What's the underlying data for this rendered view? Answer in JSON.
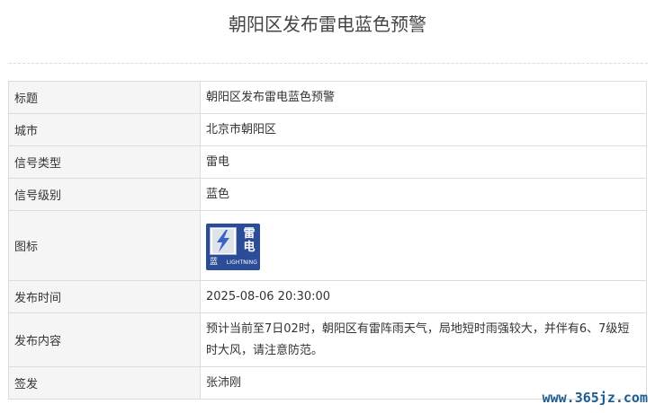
{
  "page": {
    "title": "朝阳区发布雷电蓝色预警"
  },
  "table": {
    "rows": [
      {
        "key": "标题",
        "value": "朝阳区发布雷电蓝色预警"
      },
      {
        "key": "城市",
        "value": "北京市朝阳区"
      },
      {
        "key": "信号类型",
        "value": "雷电"
      },
      {
        "key": "信号级别",
        "value": "蓝色"
      },
      {
        "key": "图标",
        "value": ""
      },
      {
        "key": "发布时间",
        "value": "2025-08-06 20:30:00"
      },
      {
        "key": "发布内容",
        "value": "预计当前至7日02时，朝阳区有雷阵雨天气，局地短时雨强较大，并伴有6、7级短时大风，请注意防范。"
      },
      {
        "key": "签发",
        "value": "张沛刚"
      }
    ]
  },
  "badge": {
    "char_top": "雷",
    "char_bottom": "电",
    "level_char": "蓝",
    "english": "LIGHTNING",
    "icon": "lightning-icon",
    "colors": {
      "background": "#2b4c97",
      "bolt": "#3a63c8"
    }
  },
  "watermark": {
    "text": "www.365jz.com"
  }
}
